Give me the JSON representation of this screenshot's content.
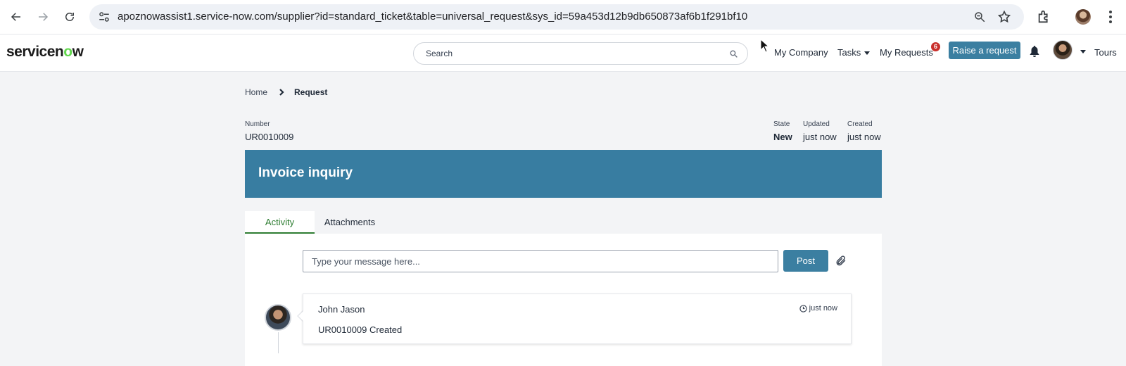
{
  "browser": {
    "url": "apoznowassist1.service-now.com/supplier?id=standard_ticket&table=universal_request&sys_id=59a453d12b9db650873af6b1f291bf10"
  },
  "header": {
    "logo_text": "servicenow",
    "search_placeholder": "Search",
    "nav": {
      "my_company": "My Company",
      "tasks": "Tasks",
      "my_requests": "My Requests",
      "my_requests_badge": "6",
      "raise_request": "Raise a request",
      "tours": "Tours"
    }
  },
  "breadcrumb": {
    "home": "Home",
    "current": "Request"
  },
  "ticket": {
    "number_label": "Number",
    "number": "UR0010009",
    "state_label": "State",
    "state": "New",
    "updated_label": "Updated",
    "updated": "just now",
    "created_label": "Created",
    "created": "just now",
    "title": "Invoice inquiry"
  },
  "tabs": [
    {
      "label": "Activity",
      "active": true
    },
    {
      "label": "Attachments",
      "active": false
    }
  ],
  "activity": {
    "message_placeholder": "Type your message here...",
    "post_label": "Post",
    "entries": [
      {
        "author": "John Jason",
        "time": "just now",
        "text": "UR0010009 Created"
      }
    ]
  },
  "colors": {
    "brand_blue": "#387da1",
    "active_tab_green": "#2e7d32",
    "badge_red": "#c9302c",
    "logo_green": "#62d84e"
  }
}
